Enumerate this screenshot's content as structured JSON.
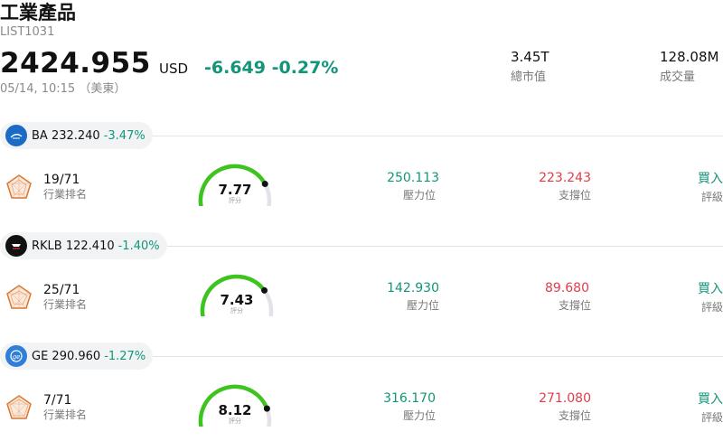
{
  "header": {
    "title": "工業產品",
    "code": "LIST1031",
    "price": "2424.955",
    "currency": "USD",
    "change": "-6.649 -0.27%",
    "time": "05/14, 10:15 （美東）",
    "stats": [
      {
        "value": "3.45T",
        "label": "總市值"
      },
      {
        "value": "128.08M",
        "label": "成交量"
      }
    ]
  },
  "colors": {
    "up_green": "#13957a",
    "down_red": "#e23c4b",
    "gauge_green": "#3ec41e",
    "gauge_track": "#e2e2e8"
  },
  "labels": {
    "rank": "行業排名",
    "resistance": "壓力位",
    "support": "支撐位",
    "rating": "評級",
    "score": "評分"
  },
  "stocks": [
    {
      "ticker": "BA 232.240",
      "change": "-3.47%",
      "rank": "19/71",
      "score": "7.77",
      "score_fraction": 0.777,
      "resistance": "250.113",
      "support": "223.243",
      "rating": "買入",
      "logo_icon": "boeing-logo-icon"
    },
    {
      "ticker": "RKLB 122.410",
      "change": "-1.40%",
      "rank": "25/71",
      "score": "7.43",
      "score_fraction": 0.743,
      "resistance": "142.930",
      "support": "89.680",
      "rating": "買入",
      "logo_icon": "rocketlab-logo-icon"
    },
    {
      "ticker": "GE 290.960",
      "change": "-1.27%",
      "rank": "7/71",
      "score": "8.12",
      "score_fraction": 0.812,
      "resistance": "316.170",
      "support": "271.080",
      "rating": "買入",
      "logo_icon": "ge-logo-icon"
    }
  ]
}
